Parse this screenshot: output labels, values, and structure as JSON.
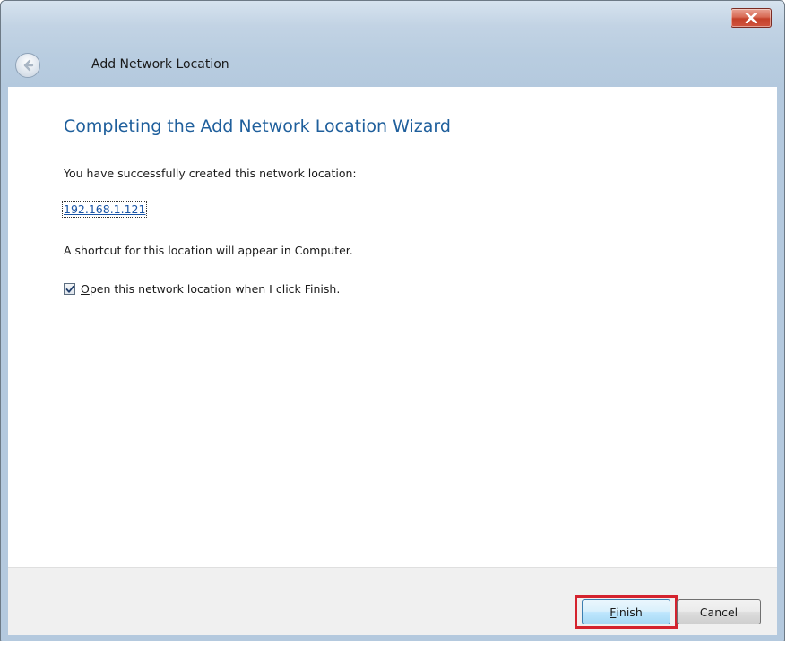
{
  "window": {
    "title": "Add Network Location"
  },
  "icons": {
    "close": "close-icon",
    "back": "back-arrow-icon",
    "check": "checkmark-icon"
  },
  "wizard": {
    "heading": "Completing the Add Network Location Wizard",
    "success_text": "You have successfully created this network location:",
    "location_link": "192.168.1.121",
    "shortcut_text": "A shortcut for this location will appear in Computer.",
    "open_checkbox": {
      "checked": true,
      "label_access_key": "O",
      "label_rest": "pen this network location when I click Finish."
    }
  },
  "buttons": {
    "finish_access_key": "F",
    "finish_rest": "inish",
    "cancel": "Cancel"
  },
  "colors": {
    "heading": "#1f5f9c",
    "link": "#1a55a6",
    "highlight_border": "#d4232e",
    "close_button": "#c4412a"
  }
}
